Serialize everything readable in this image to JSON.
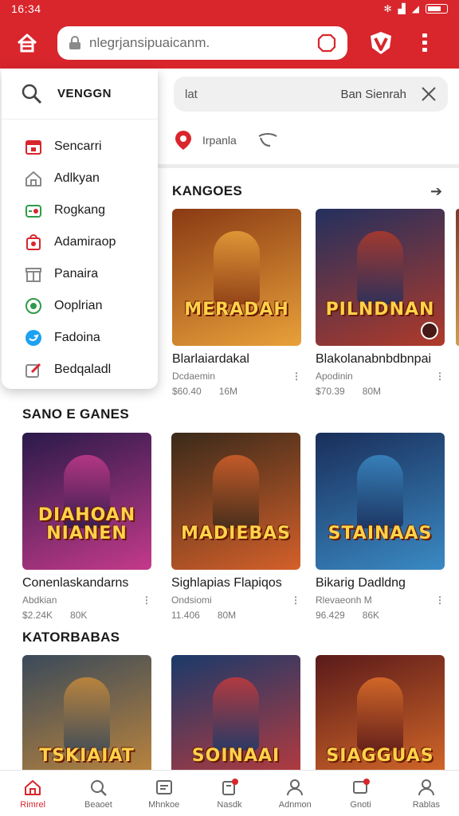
{
  "status_bar": {
    "time": "16:34"
  },
  "top_bar": {
    "url": "nlegrjansipuaicanm."
  },
  "search": {
    "query": "lat",
    "hint": "Ban Sienrah"
  },
  "location": {
    "label": "Irpanla"
  },
  "dropdown": {
    "title": "VENGGN",
    "items": [
      {
        "label": "Sencarri",
        "icon": "calendar-icon",
        "color": "#d8262c"
      },
      {
        "label": "Adlkyan",
        "icon": "home-icon",
        "color": "#888888"
      },
      {
        "label": "Rogkang",
        "icon": "game-icon",
        "color": "#2e9b4a"
      },
      {
        "label": "Adamiraop",
        "icon": "bag-icon",
        "color": "#d8262c"
      },
      {
        "label": "Panaira",
        "icon": "gift-icon",
        "color": "#888888"
      },
      {
        "label": "Ooplrian",
        "icon": "globe-icon",
        "color": "#2e9b4a"
      },
      {
        "label": "Fadoina",
        "icon": "twitter-icon",
        "color": "#1da1f2"
      },
      {
        "label": "Bedqaladl",
        "icon": "edit-icon",
        "color": "#d8262c"
      }
    ]
  },
  "sections": [
    {
      "title": "KANGOES",
      "cards": [
        {
          "name": "Blarlaiardakal",
          "sub": "Dcdaemin",
          "price": "$60.40",
          "size": "16M",
          "logo": "MERADAH",
          "bg": "#8a3a14",
          "bg2": "#e8a13a"
        },
        {
          "name": "Blakolanabnbdbnpai",
          "sub": "Apodinin",
          "price": "$70.39",
          "size": "80M",
          "logo": "PILNDNAN",
          "bg": "#23305e",
          "bg2": "#b03a2a"
        }
      ]
    },
    {
      "title": "SANO E GANES",
      "cards": [
        {
          "name": "Conenlaskandarns",
          "sub": "Abdkian",
          "price": "$2.24K",
          "size": "80K",
          "logo": "DIAHOAN NIANEN",
          "bg": "#2a1a4a",
          "bg2": "#c43a8a"
        },
        {
          "name": "Sighlapias Flapiqos",
          "sub": "Ondsiomi",
          "price": "11.406",
          "size": "80M",
          "logo": "MADIEBAS",
          "bg": "#3a2a1a",
          "bg2": "#d4602a"
        },
        {
          "name": "Bikarig Dadldng",
          "sub": "Rlevaeonh M",
          "price": "96.429",
          "size": "86K",
          "logo": "STAINAAS",
          "bg": "#1a2e5a",
          "bg2": "#3a8ac4"
        }
      ]
    },
    {
      "title": "KATORBABAS",
      "cards": [
        {
          "name": "",
          "logo": "TSKIAIAT",
          "bg": "#3a4a5a",
          "bg2": "#c88a3a"
        },
        {
          "name": "",
          "logo": "SOINAAI",
          "bg": "#1a3a6a",
          "bg2": "#c43a3a"
        },
        {
          "name": "",
          "logo": "SIAGGUAS",
          "bg": "#5a1a1a",
          "bg2": "#e0702a"
        }
      ]
    }
  ],
  "bottom_nav": [
    {
      "label": "Rimrel",
      "icon": "home-icon"
    },
    {
      "label": "Beaoet",
      "icon": "search-icon"
    },
    {
      "label": "Mhnkoe",
      "icon": "list-icon"
    },
    {
      "label": "Nasdk",
      "icon": "notification-icon"
    },
    {
      "label": "Adnmon",
      "icon": "user-icon"
    },
    {
      "label": "Gnoti",
      "icon": "message-icon"
    },
    {
      "label": "Rablas",
      "icon": "profile-icon"
    }
  ],
  "colors": {
    "brand_red": "#d8262c"
  }
}
